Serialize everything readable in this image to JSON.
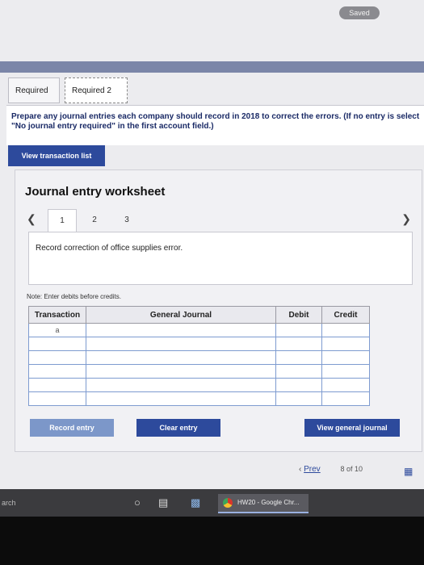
{
  "status": {
    "saved": "Saved"
  },
  "tabs": [
    {
      "label": "Required 1"
    },
    {
      "label": "Required 2"
    }
  ],
  "instructions": "Prepare any journal entries each company should record in 2018 to correct the errors. (If no entry is select \"No journal entry required\" in the first account field.)",
  "view_transaction_list": "View transaction list",
  "worksheet": {
    "title": "Journal entry worksheet",
    "pages": [
      "1",
      "2",
      "3"
    ],
    "active_page": "1",
    "description": "Record correction of office supplies error.",
    "note": "Note: Enter debits before credits."
  },
  "table": {
    "headers": [
      "Transaction",
      "General Journal",
      "Debit",
      "Credit"
    ],
    "rows": [
      [
        "a",
        "",
        "",
        ""
      ],
      [
        "",
        "",
        "",
        ""
      ],
      [
        "",
        "",
        "",
        ""
      ],
      [
        "",
        "",
        "",
        ""
      ],
      [
        "",
        "",
        "",
        ""
      ],
      [
        "",
        "",
        "",
        ""
      ]
    ]
  },
  "buttons": {
    "record": "Record entry",
    "clear": "Clear entry",
    "view_journal": "View general journal"
  },
  "pager": {
    "prev": "Prev",
    "position": "8 of 10"
  },
  "taskbar": {
    "search": "arch",
    "chrome_tab": "HW20 - Google Chr..."
  },
  "colors": {
    "accent": "#2d4a9c",
    "record_btn": "#7c97c9",
    "band": "#7b86a8"
  }
}
